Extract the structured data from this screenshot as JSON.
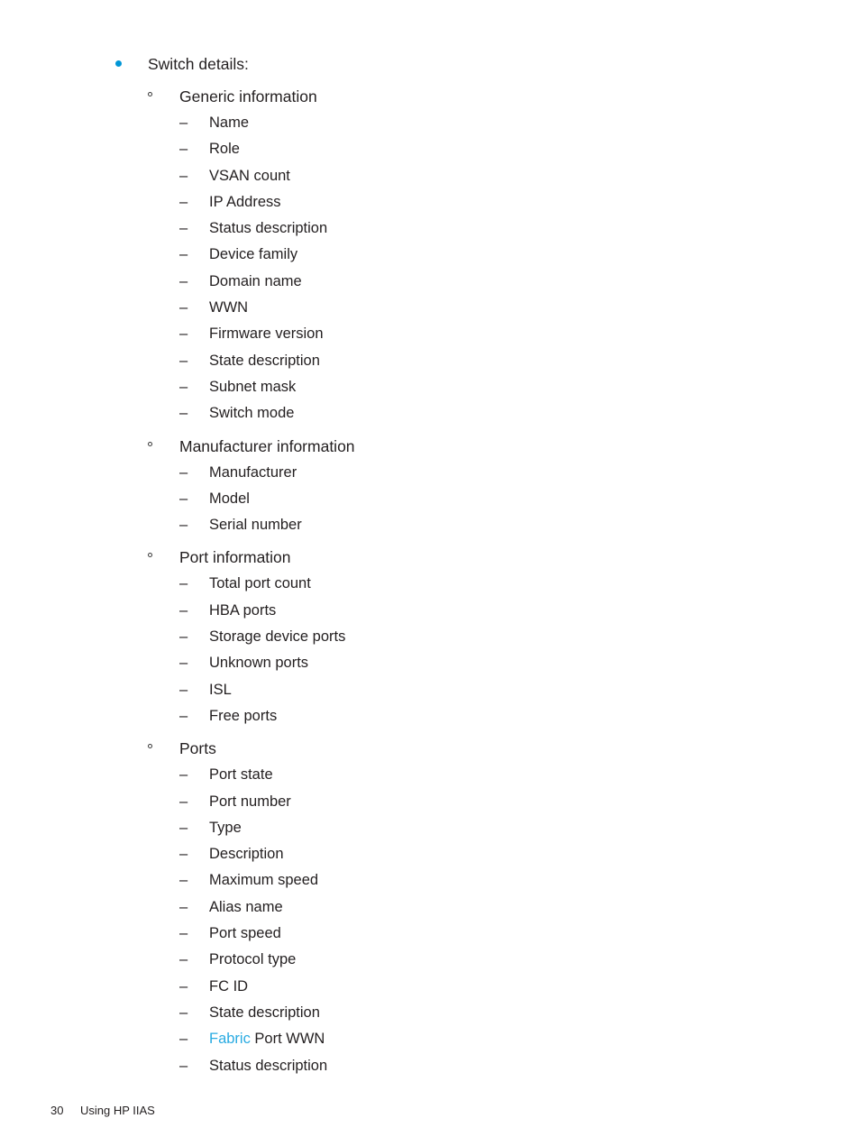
{
  "document": {
    "footer": {
      "page_number": "30",
      "chapter": "Using HP IIAS"
    },
    "markers": {
      "level1_bullet": "bullet-dot-icon",
      "level2_bullet": "hollow-circle-icon",
      "level3_bullet": "–"
    },
    "colors": {
      "bullet_blue": "#0096d6",
      "cross_reference_blue": "#29abe2",
      "body_text": "#231f20",
      "page_background": "#ffffff"
    }
  },
  "outline": {
    "root": {
      "label": "Switch details:"
    },
    "sections": [
      {
        "heading": "Generic information",
        "items": [
          {
            "text": "Name"
          },
          {
            "text": "Role"
          },
          {
            "text": "VSAN count"
          },
          {
            "text": "IP Address"
          },
          {
            "text": "Status description"
          },
          {
            "text": "Device family"
          },
          {
            "text": "Domain name"
          },
          {
            "text": "WWN"
          },
          {
            "text": "Firmware version"
          },
          {
            "text": "State description"
          },
          {
            "text": "Subnet mask"
          },
          {
            "text": "Switch mode"
          }
        ]
      },
      {
        "heading": "Manufacturer information",
        "items": [
          {
            "text": "Manufacturer"
          },
          {
            "text": "Model"
          },
          {
            "text": "Serial number"
          }
        ]
      },
      {
        "heading": "Port information",
        "items": [
          {
            "text": "Total port count"
          },
          {
            "text": "HBA ports"
          },
          {
            "text": "Storage device ports"
          },
          {
            "text": "Unknown ports"
          },
          {
            "text": "ISL"
          },
          {
            "text": "Free ports"
          }
        ]
      },
      {
        "heading": "Ports",
        "items": [
          {
            "text": "Port state"
          },
          {
            "text": "Port number"
          },
          {
            "text": "Type"
          },
          {
            "text": "Description"
          },
          {
            "text": "Maximum speed"
          },
          {
            "text": "Alias name"
          },
          {
            "text": "Port speed"
          },
          {
            "text": "Protocol type"
          },
          {
            "text": "FC ID"
          },
          {
            "text": "State description"
          },
          {
            "text": "Fabric Port WWN",
            "xref": "Fabric",
            "rest": " Port WWN"
          },
          {
            "text": "Status description"
          }
        ]
      }
    ]
  }
}
